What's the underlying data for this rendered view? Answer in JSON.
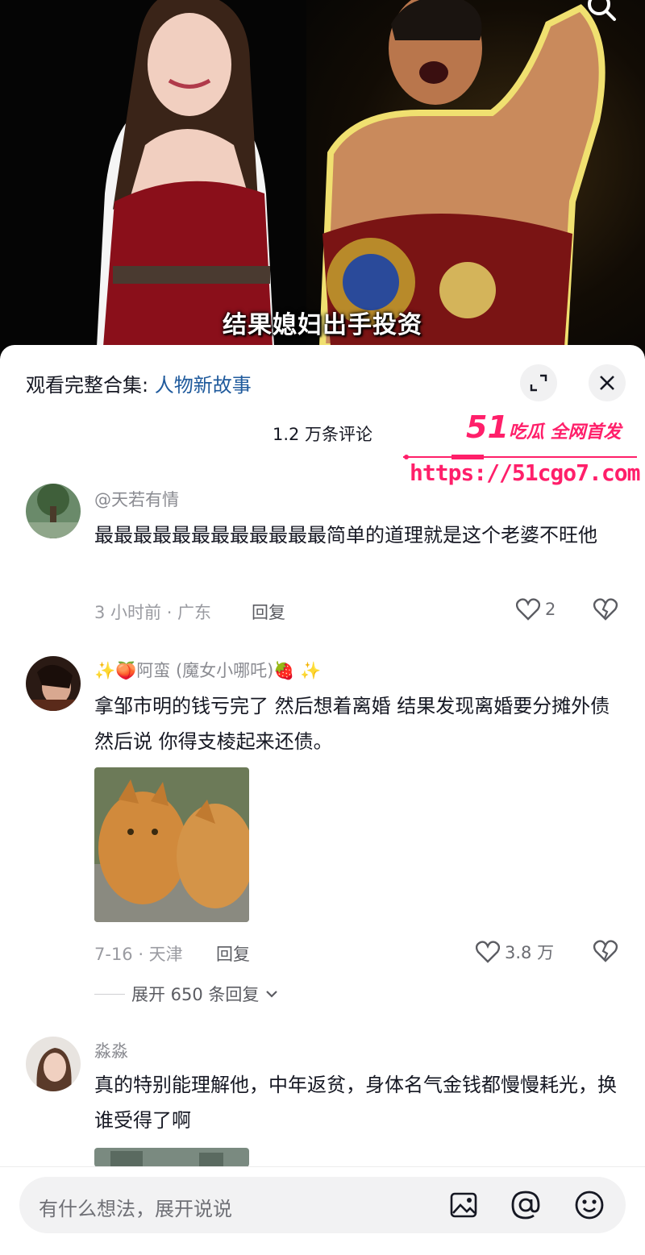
{
  "video": {
    "subtitle": "结果媳妇出手投资"
  },
  "panel": {
    "collection_prefix": "观看完整合集: ",
    "collection_link": "人物新故事",
    "comment_count": "1.2 万条评论"
  },
  "watermark": {
    "logo": "51",
    "tag": "吃瓜 全网首发",
    "url": "https://51cgo7.com"
  },
  "comments": [
    {
      "username": "@天若有情",
      "text": "最最最最最最最最最最最最简单的道理就是这个老婆不旺他",
      "time_location": "3 小时前 · 广东",
      "reply_label": "回复",
      "likes": "2"
    },
    {
      "username": "✨🍑阿蛮 (魔女小哪吒)🍓 ✨",
      "text": "拿邹市明的钱亏完了 然后想着离婚 结果发现离婚要分摊外债 然后说 你得支棱起来还债。",
      "time_location": "7-16 · 天津",
      "reply_label": "回复",
      "likes": "3.8 万",
      "expand_label": "展开 650 条回复"
    },
    {
      "username": "淼淼",
      "text": "真的特别能理解他，中年返贫，身体名气金钱都慢慢耗光，换谁受得了啊"
    }
  ],
  "input": {
    "placeholder": "有什么想法，展开说说"
  },
  "colors": {
    "link": "#1f5a9c",
    "watermark": "#ff1f6a",
    "text": "#161823",
    "muted": "#8a8b91"
  }
}
